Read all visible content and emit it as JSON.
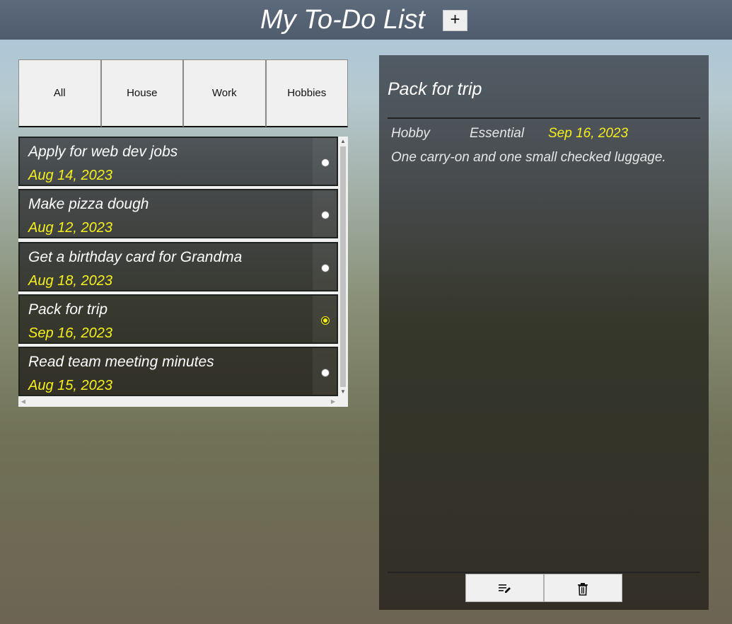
{
  "header": {
    "title": "My To-Do List",
    "add_label": "+"
  },
  "tabs": [
    {
      "label": "All"
    },
    {
      "label": "House"
    },
    {
      "label": "Work"
    },
    {
      "label": "Hobbies"
    }
  ],
  "todos": [
    {
      "title": "Apply for web dev jobs",
      "date": "Aug 14, 2023",
      "selected": false
    },
    {
      "title": "Make pizza dough",
      "date": "Aug 12, 2023",
      "selected": false
    },
    {
      "title": "Get a birthday card for Grandma",
      "date": "Aug 18, 2023",
      "selected": false
    },
    {
      "title": "Pack for trip",
      "date": "Sep 16, 2023",
      "selected": true
    },
    {
      "title": "Read team meeting minutes",
      "date": "Aug 15, 2023",
      "selected": false
    }
  ],
  "detail": {
    "title": "Pack for trip",
    "category": "Hobby",
    "priority": "Essential",
    "date": "Sep 16, 2023",
    "description": "One carry-on and one small checked luggage."
  },
  "actions": {
    "edit_icon": "edit-list-icon",
    "delete_icon": "trash-icon"
  },
  "colors": {
    "accent_date": "#f4f01c",
    "header_bg": "#52606f"
  }
}
